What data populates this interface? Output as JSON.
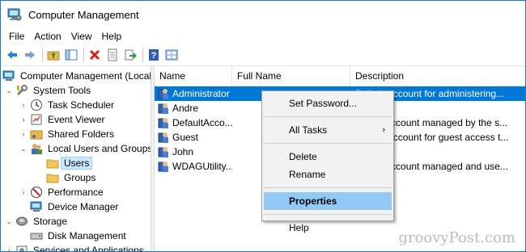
{
  "window": {
    "title": "Computer Management"
  },
  "menubar": {
    "items": [
      "File",
      "Action",
      "View",
      "Help"
    ]
  },
  "toolbar": {
    "buttons": [
      "back-arrow-icon",
      "forward-arrow-icon",
      "up-folder-icon",
      "show-hide-tree-icon",
      "delete-icon",
      "properties-icon",
      "export-icon",
      "help-icon",
      "view-icon"
    ]
  },
  "tree": {
    "items": [
      {
        "label": "Computer Management (Local",
        "icon": "computer-icon",
        "expander": "none"
      },
      {
        "label": "System Tools",
        "icon": "tools-icon",
        "expander": "expanded"
      },
      {
        "label": "Task Scheduler",
        "icon": "clock-icon",
        "expander": "collapsed"
      },
      {
        "label": "Event Viewer",
        "icon": "event-viewer-icon",
        "expander": "collapsed"
      },
      {
        "label": "Shared Folders",
        "icon": "shared-folder-icon",
        "expander": "collapsed"
      },
      {
        "label": "Local Users and Groups",
        "icon": "users-groups-icon",
        "expander": "expanded"
      },
      {
        "label": "Users",
        "icon": "folder-icon",
        "expander": "none"
      },
      {
        "label": "Groups",
        "icon": "folder-icon",
        "expander": "none"
      },
      {
        "label": "Performance",
        "icon": "performance-icon",
        "expander": "collapsed"
      },
      {
        "label": "Device Manager",
        "icon": "device-manager-icon",
        "expander": "none"
      },
      {
        "label": "Storage",
        "icon": "storage-icon",
        "expander": "expanded"
      },
      {
        "label": "Disk Management",
        "icon": "disk-icon",
        "expander": "none"
      },
      {
        "label": "Services and Applications",
        "icon": "services-icon",
        "expander": "collapsed"
      }
    ]
  },
  "list": {
    "columns": [
      "Name",
      "Full Name",
      "Description"
    ],
    "rows": [
      {
        "name": "Administrator",
        "full_name": "",
        "description": "Built-in account for administering..."
      },
      {
        "name": "Andre",
        "full_name": "",
        "description": ""
      },
      {
        "name": "DefaultAcco...",
        "full_name": "",
        "description": "A user account managed by the s..."
      },
      {
        "name": "Guest",
        "full_name": "",
        "description": "Built-in account for guest access t..."
      },
      {
        "name": "John",
        "full_name": "",
        "description": ""
      },
      {
        "name": "WDAGUtility...",
        "full_name": "",
        "description": "A user account managed and use..."
      }
    ]
  },
  "context_menu": {
    "set_password": "Set Password...",
    "all_tasks": "All Tasks",
    "submenu_arrow": "›",
    "delete": "Delete",
    "rename": "Rename",
    "properties": "Properties",
    "help": "Help"
  },
  "watermark": "groovyPost.com",
  "colors": {
    "selection_blue": "#0078d7",
    "menu_hover": "#91c9f7",
    "tree_selected": "#cce8ff",
    "window_border": "#1979ca"
  }
}
